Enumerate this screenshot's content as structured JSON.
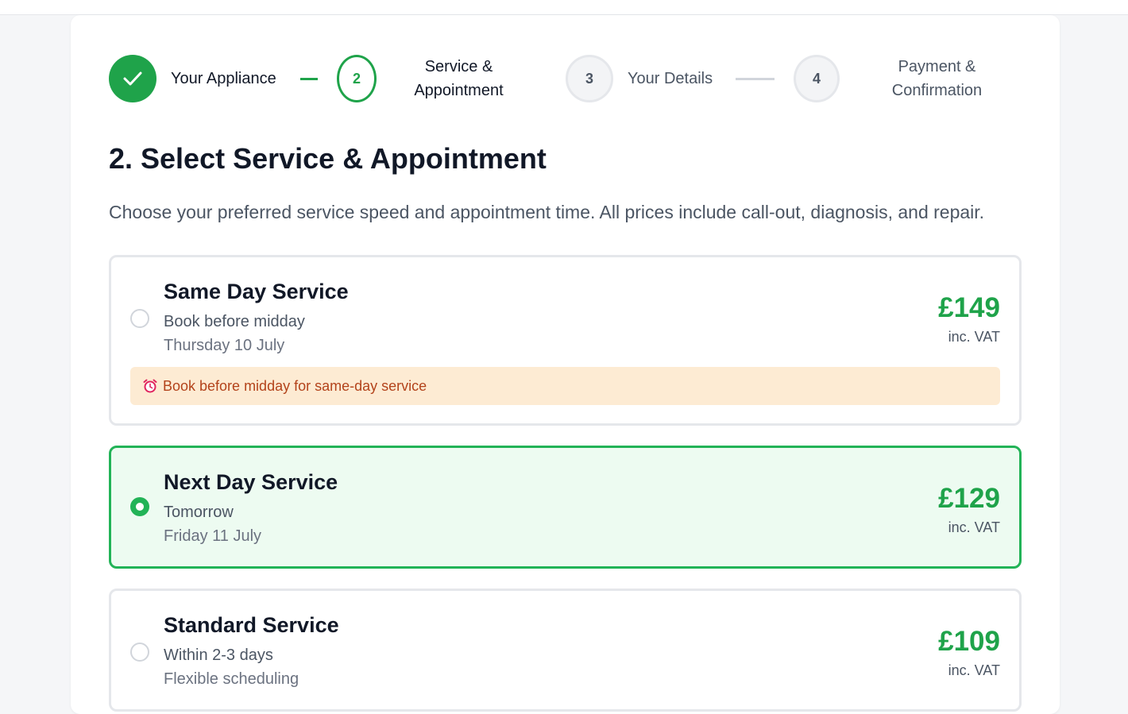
{
  "stepper": {
    "steps": [
      {
        "number": "",
        "label": "Your Appliance",
        "state": "done"
      },
      {
        "number": "2",
        "label_line1": "Service &",
        "label_line2": "Appointment",
        "state": "active"
      },
      {
        "number": "3",
        "label": "Your Details",
        "state": "todo"
      },
      {
        "number": "4",
        "label_line1": "Payment &",
        "label_line2": "Confirmation",
        "state": "todo"
      }
    ]
  },
  "page": {
    "title": "2. Select Service & Appointment",
    "subtitle": "Choose your preferred service speed and appointment time. All prices include call-out, diagnosis, and repair."
  },
  "options": [
    {
      "name": "Same Day Service",
      "line1": "Book before midday",
      "line2": "Thursday 10 July",
      "price": "£149",
      "vat": "inc. VAT",
      "selected": false,
      "notice": "Book before midday for same-day service",
      "notice_icon": "alarm-clock-icon"
    },
    {
      "name": "Next Day Service",
      "line1": "Tomorrow",
      "line2": "Friday 11 July",
      "price": "£129",
      "vat": "inc. VAT",
      "selected": true
    },
    {
      "name": "Standard Service",
      "line1": "Within 2-3 days",
      "line2": "Flexible scheduling",
      "price": "£109",
      "vat": "inc. VAT",
      "selected": false
    }
  ],
  "colors": {
    "accent": "#1fa34a",
    "selected_bg": "#edfbf1",
    "notice_bg": "#fdebd3",
    "notice_text": "#b3431b"
  }
}
